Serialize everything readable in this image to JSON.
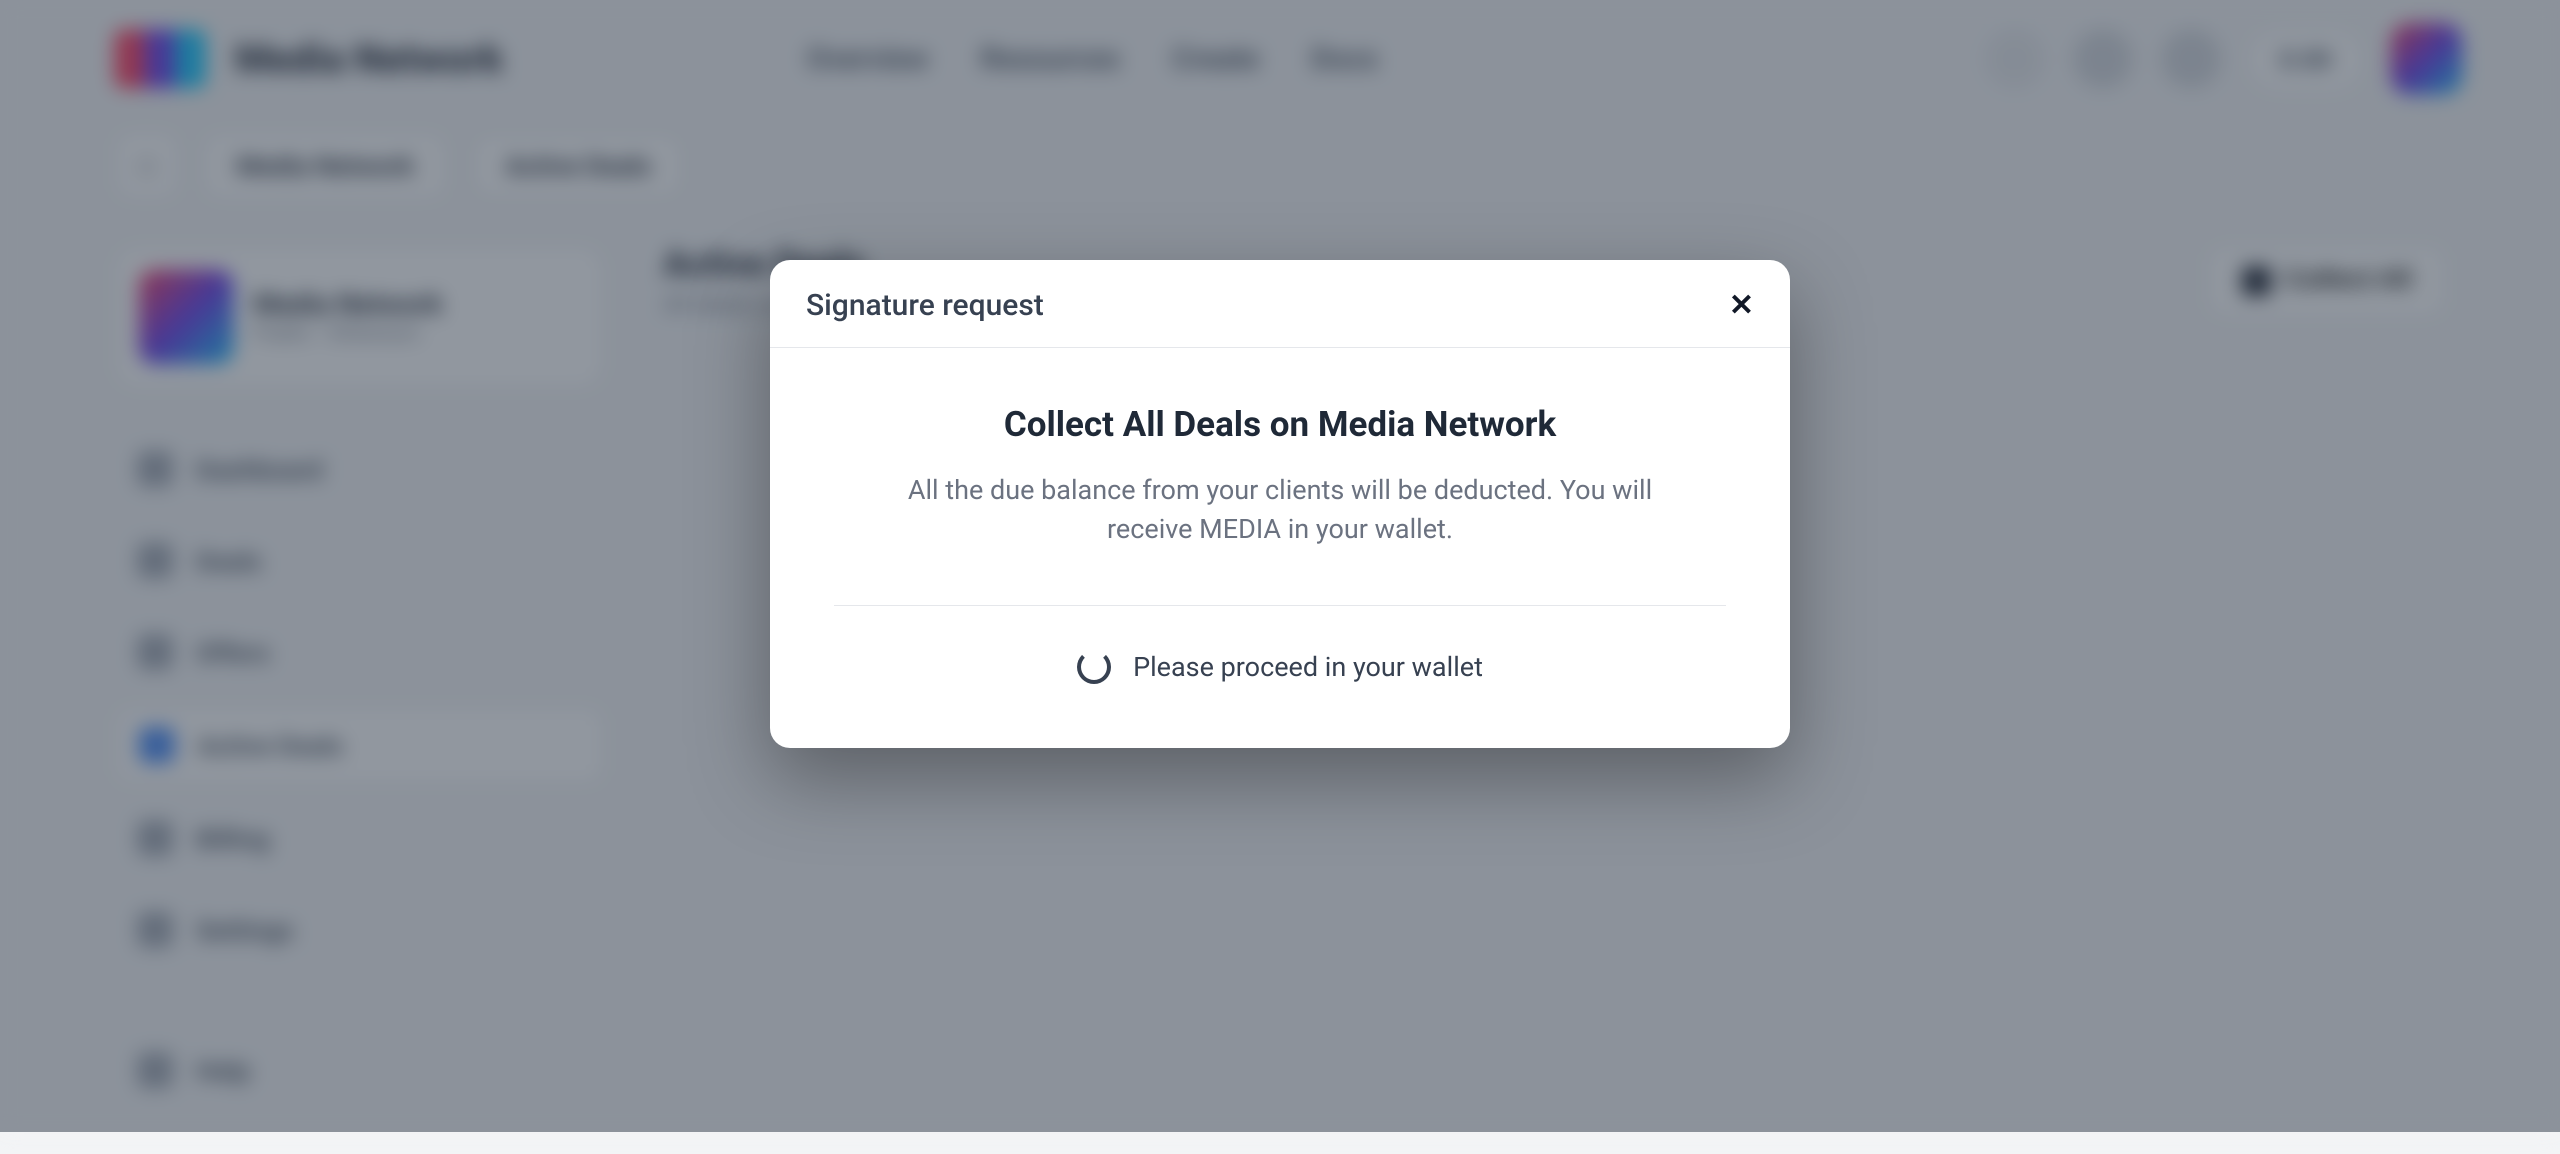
{
  "brand": "Media Network",
  "nav": [
    "Overview",
    "Resources",
    "Create",
    "Docs"
  ],
  "header": {
    "balance_label": "0.00"
  },
  "breadcrumbs": {
    "home_icon": "home-icon",
    "items": [
      "Media Network",
      "Active Deals"
    ]
  },
  "sidebar": {
    "project": {
      "title": "Media Network",
      "subtitle": "Public • Ethereum"
    },
    "items": [
      {
        "label": "Dashboard"
      },
      {
        "label": "Deals"
      },
      {
        "label": "Offers"
      },
      {
        "label": "Active Deals"
      },
      {
        "label": "Billing"
      },
      {
        "label": "Settings"
      }
    ],
    "footer_label": "Help"
  },
  "content": {
    "title": "Active Deals",
    "subtitle": "All deals currently active on this resource",
    "collect_button": "Collect All"
  },
  "modal": {
    "title": "Signature request",
    "heading": "Collect All Deals on Media Network",
    "body": "All the due balance from your clients will be deducted. You will receive MEDIA in your wallet.",
    "proceed": "Please proceed in your wallet"
  }
}
